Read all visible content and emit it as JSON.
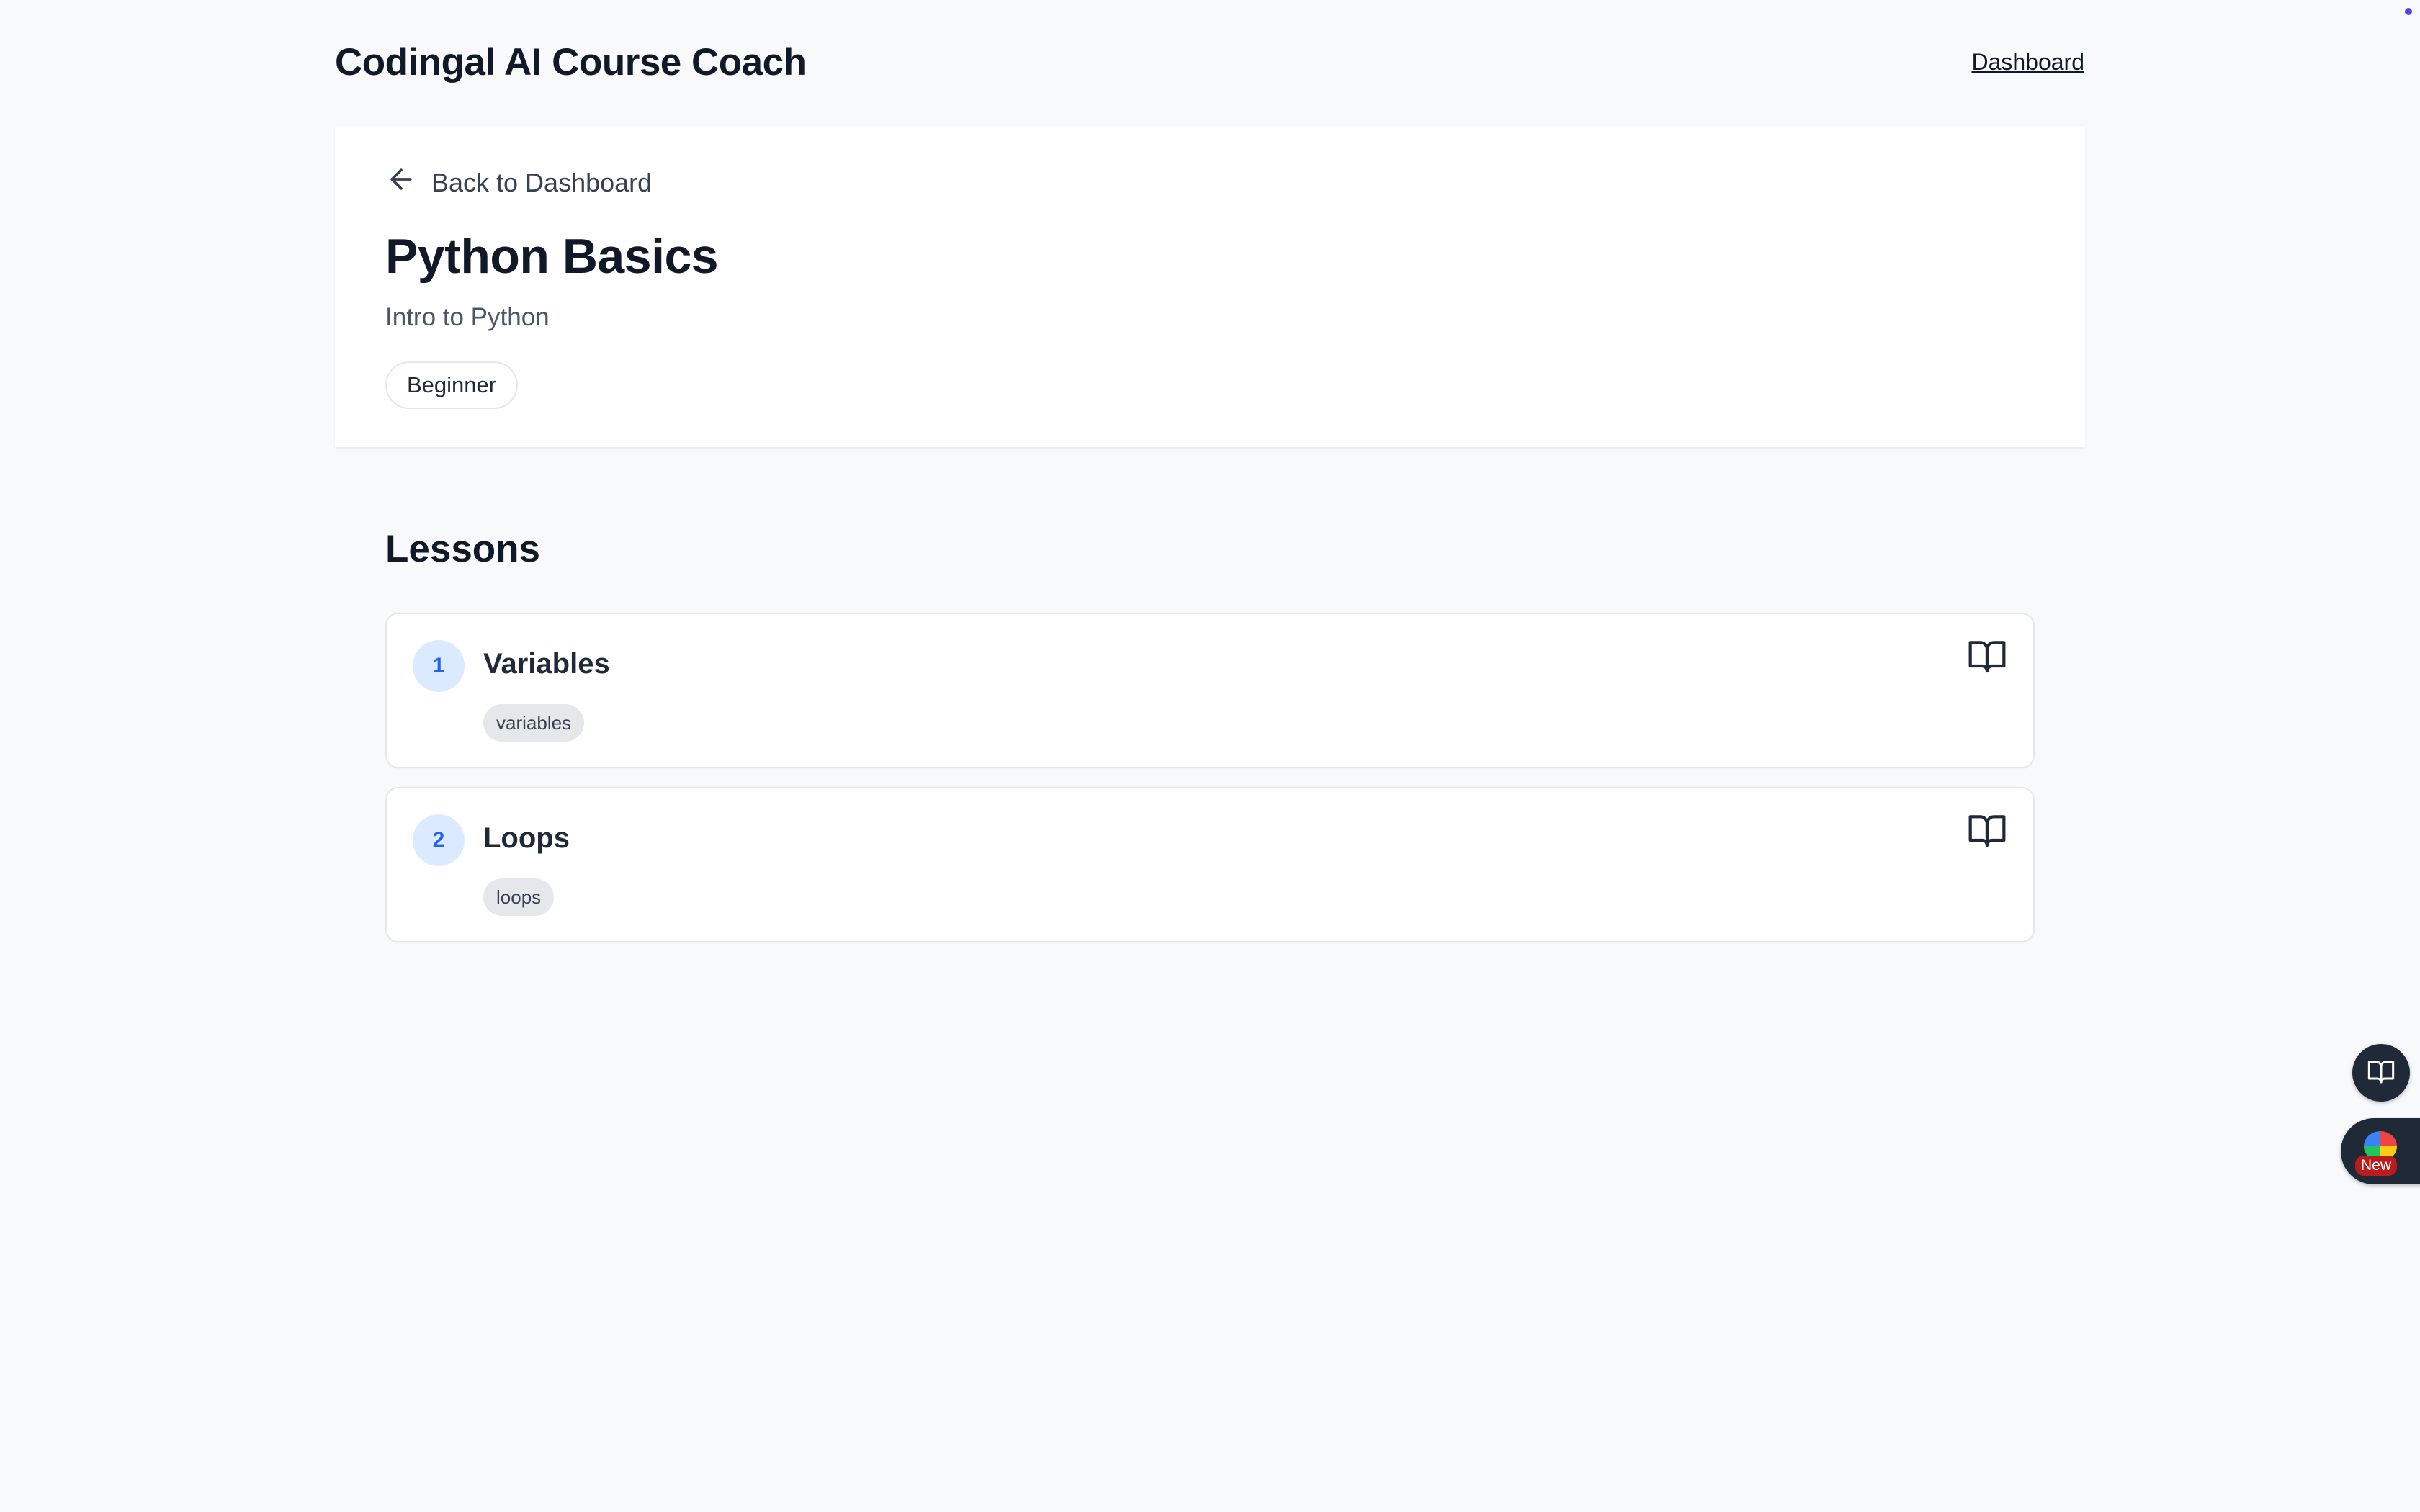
{
  "header": {
    "app_title": "Codingal AI Course Coach",
    "nav_link": "Dashboard"
  },
  "course": {
    "back_label": "Back to Dashboard",
    "title": "Python Basics",
    "subtitle": "Intro to Python",
    "level": "Beginner"
  },
  "lessons": {
    "heading": "Lessons",
    "items": [
      {
        "number": "1",
        "title": "Variables",
        "tag": "variables"
      },
      {
        "number": "2",
        "title": "Loops",
        "tag": "loops"
      }
    ]
  },
  "widgets": {
    "new_badge": "New"
  },
  "colors": {
    "accent": "#2563eb",
    "accent_light": "#dbeafe",
    "background": "#f8f9fb"
  }
}
